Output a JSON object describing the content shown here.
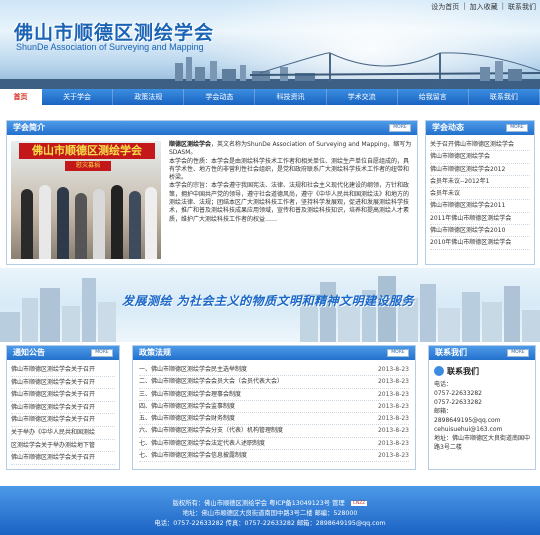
{
  "header": {
    "title": "佛山市顺德区测绘学会",
    "subtitle": "ShunDe Association of Surveying and Mapping",
    "links": [
      "设为首页",
      "加入收藏",
      "联系我们"
    ]
  },
  "nav": {
    "items": [
      "首页",
      "关于学会",
      "政策法规",
      "学会动态",
      "科技资讯",
      "学术交流",
      "给我留言",
      "联系我们"
    ]
  },
  "intro": {
    "title": "学会简介",
    "more": "MORE",
    "photo_banner": "佛山市顺德区测绘学会",
    "photo_sub": "慰灾募捐",
    "lead": "顺德区测绘学会",
    "paragraphs": [
      "，英文名称为ShunDe Association of Surveying and Mapping，缩写为SDASM。",
      "本学会的性质：本学会是由测绘科学技术工作者和相关单位、测绘生产单位自愿组成的，具有学术性、地方性的非营利性社会组织，是党和政府联系广大测绘科学技术工作者的纽带和桥梁。",
      "本学会的宗旨：本学会遵守我国宪法、法律、法规和社会主义现代化建设的纲领，方针和政策，拥护中国共产党的领导，遵守社会道德风尚，遵守《中华人民共和国测绘法》和地方的测绘法律、法规；团结本区广大测绘科技工作者，坚持科学发展观，促进和发展测绘科学技术，推广和普及测绘科技成果应用领域，宣传和普及测绘科技知识，培养和提高测绘人才素质，维护广大测绘科技工作者的权益……"
    ]
  },
  "dynamics": {
    "title": "学会动态",
    "more": "MORE",
    "items": [
      "关于召开佛山市顺德区测绘学会",
      "佛山市顺德区测绘学会",
      "佛山市顺德区测绘学会2012",
      "会员年未议--2012年1",
      "会员年未议",
      "佛山市顺德区测绘学会2011",
      "2011年佛山市顺德区测绘学会",
      "佛山市顺德区测绘学会2010",
      "2010年佛山市顺德区测绘学会"
    ]
  },
  "slogan": {
    "text": "发展测绘  为社会主义的物质文明和精神文明建设服务"
  },
  "notices": {
    "title": "通知公告",
    "more": "MORE",
    "items": [
      "佛山市顺德区测绘学会关于召开",
      "佛山市顺德区测绘学会关于召开",
      "佛山市顺德区测绘学会关于召开",
      "佛山市顺德区测绘学会关于召开",
      "佛山市顺德区测绘学会关于召开",
      "关于举办《中华人民共和国测绘",
      "区测绘学会关于举办测绘地下管",
      "佛山市顺德区测绘学会关于召开"
    ]
  },
  "laws": {
    "title": "政策法规",
    "more": "MORE",
    "items": [
      {
        "title": "一、佛山市顺德区测绘学会民主选举制度",
        "date": "2013-8-23"
      },
      {
        "title": "二、佛山市顺德区测绘学会会员大会（会员代表大会）",
        "date": "2013-8-23"
      },
      {
        "title": "三、佛山市顺德区测绘学会理事会制度",
        "date": "2013-8-23"
      },
      {
        "title": "四、佛山市顺德区测绘学会监事制度",
        "date": "2013-8-23"
      },
      {
        "title": "五、佛山市顺德区测绘学会财务制度",
        "date": "2013-8-23"
      },
      {
        "title": "六、佛山市顺德区测绘学会分支（代表）机构管理制度",
        "date": "2013-8-23"
      },
      {
        "title": "七、佛山市顺德区测绘学会法定代表人述职制度",
        "date": "2013-8-23"
      },
      {
        "title": "七、佛山市顺德区测绘学会信息披露制度",
        "date": "2013-8-23"
      }
    ]
  },
  "contact": {
    "title": "联系我们",
    "more": "MORE",
    "heading": "联系我们",
    "lines": [
      "电话：",
      "0757-22633282",
      "0757-22633282",
      "邮箱：",
      "2898649195@qq.com",
      "cehuisuehui@163.com",
      "地址：佛山市顺德区大良街道南国中路3号二楼"
    ]
  },
  "footer": {
    "line1": "版权所有：佛山市顺德区测绘学会  粤ICP备13049123号  管理",
    "badge": "CNZZ",
    "line2": "地址：佛山市顺德区大良街道南国中路3号二楼  邮编：528000",
    "line3": "电话：0757-22633282  传真：0757-22633282  邮箱：2898649195@qq.com"
  }
}
